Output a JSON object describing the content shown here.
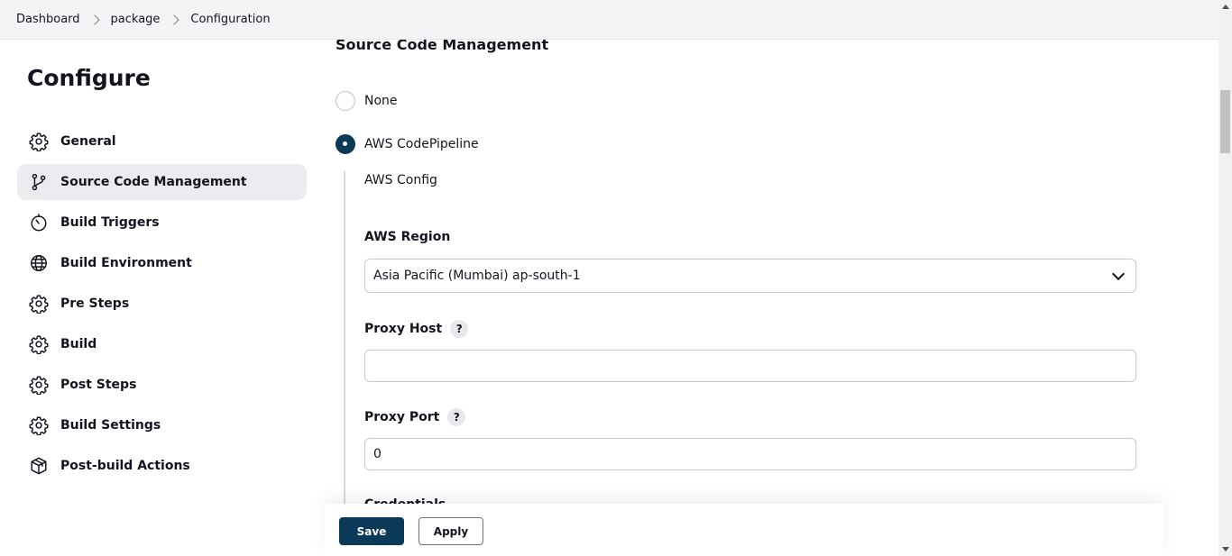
{
  "breadcrumb": [
    "Dashboard",
    "package",
    "Configuration"
  ],
  "sidebar": {
    "title": "Configure",
    "active": "Source Code Management",
    "items": [
      {
        "label": "General",
        "icon": "gear-icon"
      },
      {
        "label": "Source Code Management",
        "icon": "git-branch-icon"
      },
      {
        "label": "Build Triggers",
        "icon": "timer-icon"
      },
      {
        "label": "Build Environment",
        "icon": "globe-icon"
      },
      {
        "label": "Pre Steps",
        "icon": "gear-icon"
      },
      {
        "label": "Build",
        "icon": "gear-icon"
      },
      {
        "label": "Post Steps",
        "icon": "gear-icon"
      },
      {
        "label": "Build Settings",
        "icon": "gear-icon"
      },
      {
        "label": "Post-build Actions",
        "icon": "package-icon"
      }
    ]
  },
  "main": {
    "section_title": "Source Code Management",
    "scm_options": [
      {
        "label": "None",
        "selected": false
      },
      {
        "label": "AWS CodePipeline",
        "selected": true
      }
    ],
    "aws_config_heading": "AWS Config",
    "region": {
      "label": "AWS Region",
      "value": "Asia Pacific (Mumbai) ap-south-1"
    },
    "proxy_host": {
      "label": "Proxy Host",
      "help": "?",
      "value": ""
    },
    "proxy_port": {
      "label": "Proxy Port",
      "help": "?",
      "value": "0"
    },
    "next_field_partial": "Credentials"
  },
  "actions": {
    "save_label": "Save",
    "apply_label": "Apply"
  },
  "colors": {
    "primary": "#0b3a58",
    "active_bg": "#ebebf0",
    "topbar_bg": "#f4f4f6"
  }
}
